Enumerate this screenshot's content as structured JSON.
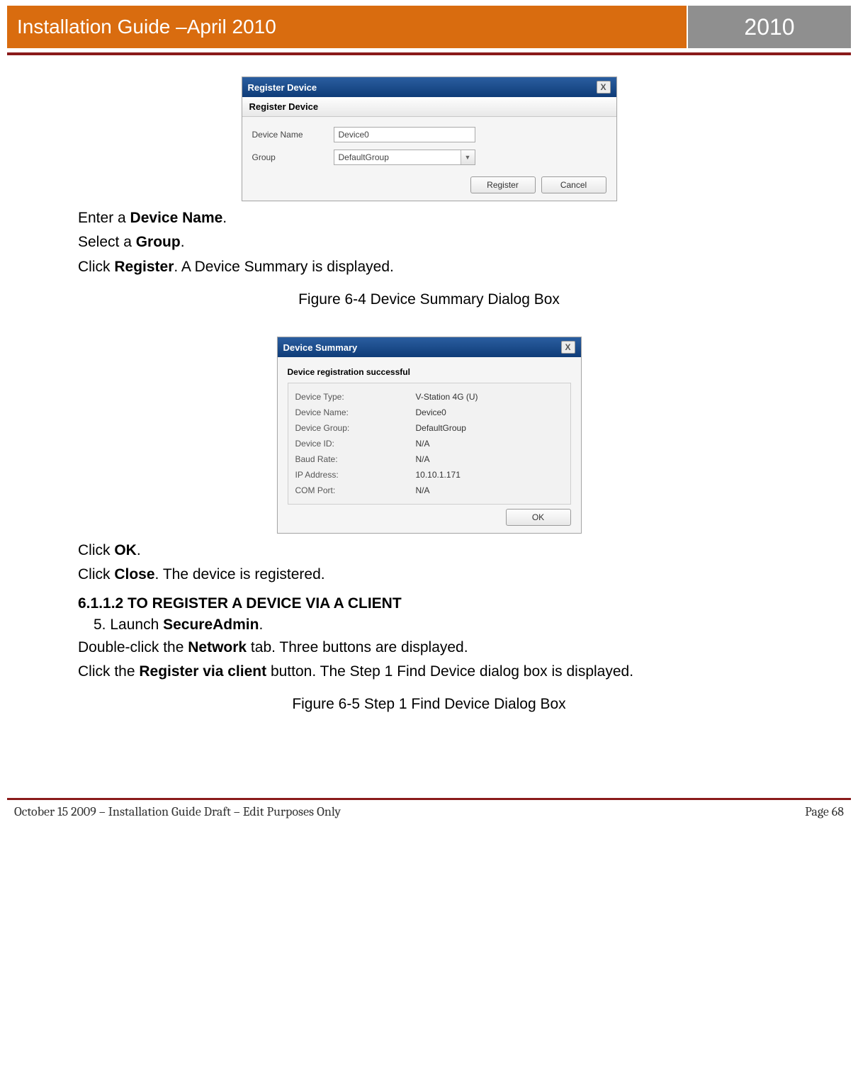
{
  "header": {
    "title": "Installation Guide –April 2010",
    "year": "2010"
  },
  "dialog1": {
    "title": "Register Device",
    "tab": "Register Device",
    "device_name_label": "Device Name",
    "device_name_value": "Device0",
    "group_label": "Group",
    "group_value": "DefaultGroup",
    "register_btn": "Register",
    "cancel_btn": "Cancel"
  },
  "para1": {
    "p1_a": "Enter a ",
    "p1_b": "Device Name",
    "p1_c": ".",
    "p2_a": "Select a ",
    "p2_b": "Group",
    "p2_c": ".",
    "p3_a": "Click ",
    "p3_b": "Register",
    "p3_c": ". A Device Summary is displayed."
  },
  "fig1_caption": "Figure 6-4 Device Summary Dialog Box",
  "dialog2": {
    "title": "Device Summary",
    "status": "Device registration successful",
    "rows": [
      {
        "label": "Device Type:",
        "value": "V-Station 4G (U)"
      },
      {
        "label": "Device Name:",
        "value": "Device0"
      },
      {
        "label": "Device Group:",
        "value": "DefaultGroup"
      },
      {
        "label": "Device ID:",
        "value": "N/A"
      },
      {
        "label": "Baud Rate:",
        "value": "N/A"
      },
      {
        "label": "IP Address:",
        "value": "10.10.1.171"
      },
      {
        "label": "COM Port:",
        "value": "N/A"
      }
    ],
    "ok_btn": "OK"
  },
  "para2": {
    "p1_a": "Click ",
    "p1_b": "OK",
    "p1_c": ".",
    "p2_a": "Click ",
    "p2_b": "Close",
    "p2_c": ". The device is registered."
  },
  "section": "6.1.1.2 TO REGISTER A DEVICE VIA A CLIENT",
  "step5_a": "5.  Launch ",
  "step5_b": "SecureAdmin",
  "step5_c": ".",
  "para3": {
    "p1_a": "Double-click the ",
    "p1_b": "Network",
    "p1_c": " tab. Three buttons are displayed.",
    "p2_a": "Click the ",
    "p2_b": "Register via client",
    "p2_c": " button. The Step 1 Find Device dialog box is displayed."
  },
  "fig2_caption": "Figure 6-5 Step 1 Find Device Dialog Box",
  "footer": {
    "left": "October 15 2009 – Installation Guide Draft – Edit Purposes Only",
    "right": "Page 68"
  }
}
